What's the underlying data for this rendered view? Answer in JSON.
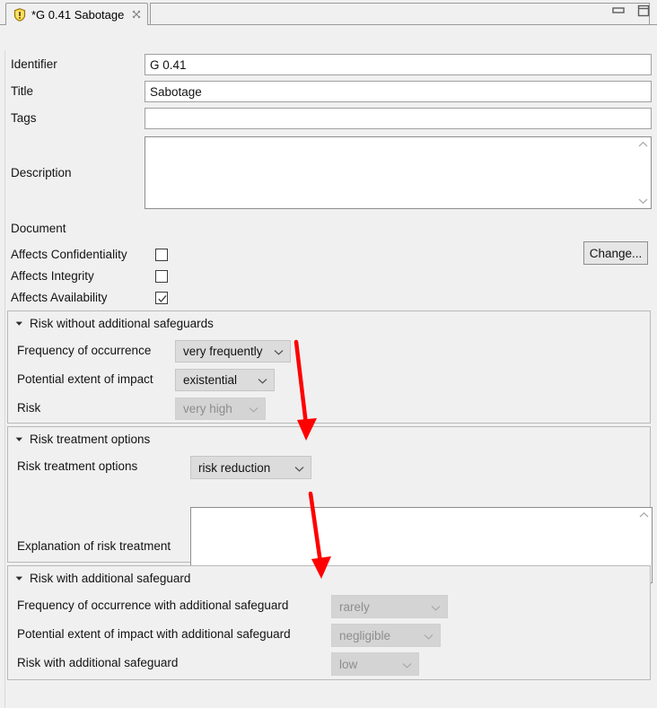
{
  "window": {
    "minimize_label": "Minimize",
    "maximize_label": "Restore"
  },
  "tab": {
    "title": "*G 0.41 Sabotage",
    "icon": "threat-shield-icon",
    "close_icon": "close-icon"
  },
  "form": {
    "identifier": {
      "label": "Identifier",
      "value": "G 0.41"
    },
    "title": {
      "label": "Title",
      "value": "Sabotage"
    },
    "tags": {
      "label": "Tags",
      "value": "",
      "placeholder": ""
    },
    "description": {
      "label": "Description",
      "value": "",
      "placeholder": ""
    },
    "document": {
      "label": "Document",
      "change_button": "Change..."
    },
    "checkboxes": [
      {
        "label": "Affects Confidentiality",
        "checked": false
      },
      {
        "label": "Affects Integrity",
        "checked": false
      },
      {
        "label": "Affects Availability",
        "checked": true
      }
    ]
  },
  "groups": {
    "risk_without": {
      "title": "Risk without additional safeguards",
      "expanded": true,
      "rows": [
        {
          "label": "Frequency of occurrence",
          "value": "very frequently",
          "disabled": false
        },
        {
          "label": "Potential extent of impact",
          "value": "existential",
          "disabled": false
        },
        {
          "label": "Risk",
          "value": "very high",
          "disabled": true
        }
      ]
    },
    "risk_treatment": {
      "title": "Risk treatment options",
      "expanded": true,
      "option_label": "Risk treatment options",
      "option_value": "risk reduction",
      "explanation_label": "Explanation of risk treatment",
      "explanation_value": ""
    },
    "risk_with": {
      "title": "Risk with additional safeguard",
      "expanded": true,
      "rows": [
        {
          "label": "Frequency of occurrence with additional safeguard",
          "value": "rarely",
          "disabled": true
        },
        {
          "label": "Potential extent of impact with additional safeguard",
          "value": "negligible",
          "disabled": true
        },
        {
          "label": "Risk with additional safeguard",
          "value": "low",
          "disabled": true
        }
      ]
    }
  },
  "annotations": {
    "arrow_color": "#ff0000",
    "arrows": [
      {
        "name": "arrow-to-risk-treatment"
      },
      {
        "name": "arrow-to-risk-with-safeguard"
      }
    ]
  }
}
